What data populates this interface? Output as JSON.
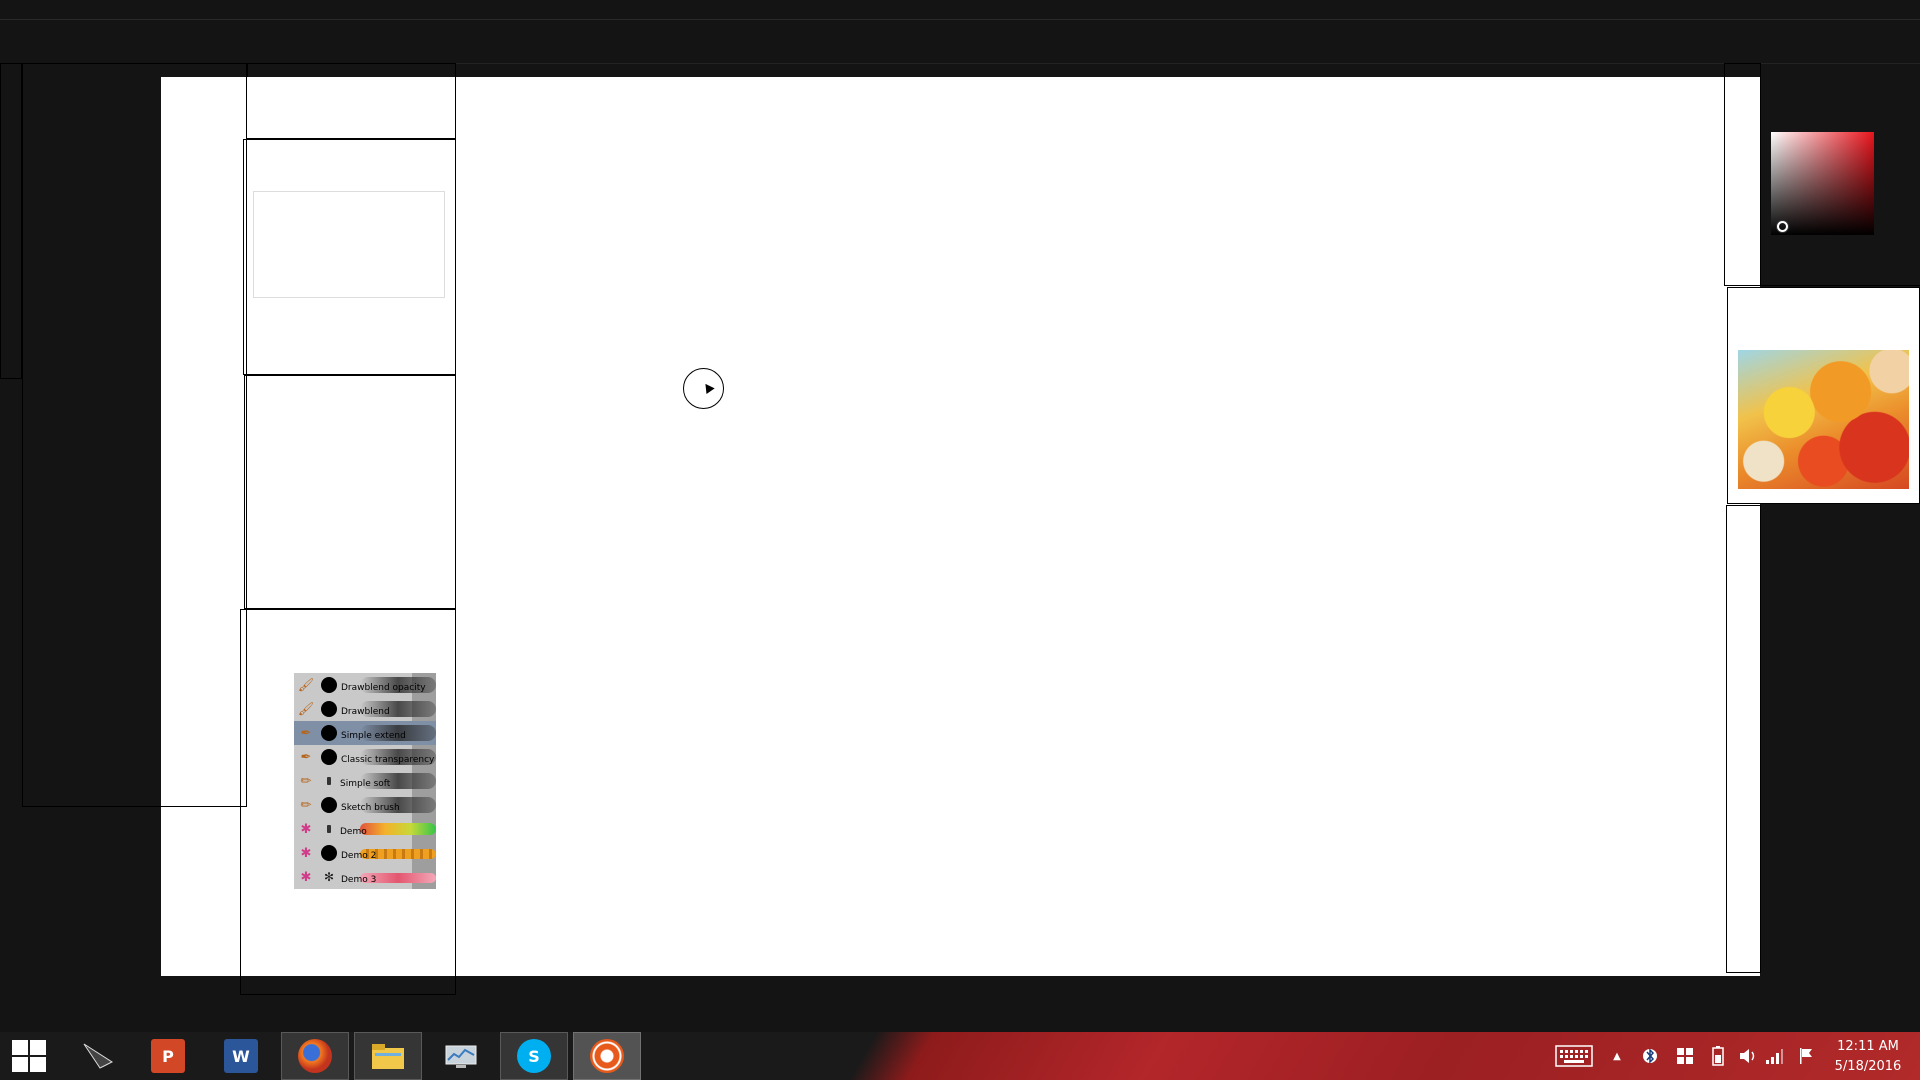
{
  "brushes": [
    {
      "label": "Drawblend opacity",
      "icon": "brush-icon",
      "tip": "round"
    },
    {
      "label": "Drawblend",
      "icon": "brush-icon",
      "tip": "round"
    },
    {
      "label": "Simple extend",
      "icon": "pen-icon",
      "tip": "round",
      "selected": true
    },
    {
      "label": "Classic transparency",
      "icon": "pen-icon",
      "tip": "round"
    },
    {
      "label": "Simple soft",
      "icon": "pencil-icon",
      "tip": "small"
    },
    {
      "label": "Sketch brush",
      "icon": "pencil-icon",
      "tip": "round"
    },
    {
      "label": "Demo",
      "icon": "star-icon",
      "tip": "small"
    },
    {
      "label": "Demo 2",
      "icon": "star-icon",
      "tip": "round"
    },
    {
      "label": "Demo 3",
      "icon": "star-icon",
      "tip": "splat"
    }
  ],
  "taskbar": {
    "apps": [
      {
        "name": "start",
        "icon": "windows-logo-icon"
      },
      {
        "name": "inkscape",
        "icon": "pen-nib-icon"
      },
      {
        "name": "powerpoint",
        "icon": "powerpoint-icon",
        "glyph": "P"
      },
      {
        "name": "word",
        "icon": "word-icon",
        "glyph": "W"
      },
      {
        "name": "firefox",
        "icon": "firefox-icon"
      },
      {
        "name": "file-explorer",
        "icon": "folder-icon"
      },
      {
        "name": "resource-monitor",
        "icon": "monitor-icon"
      },
      {
        "name": "skype",
        "icon": "skype-icon",
        "glyph": "S"
      },
      {
        "name": "paint-app",
        "icon": "paint-app-icon"
      }
    ],
    "clock_time": "12:11 AM",
    "clock_date": "5/18/2016"
  },
  "colors": {
    "accent": "#e8141c",
    "taskbar": "#b3262a",
    "background": "#141414"
  }
}
